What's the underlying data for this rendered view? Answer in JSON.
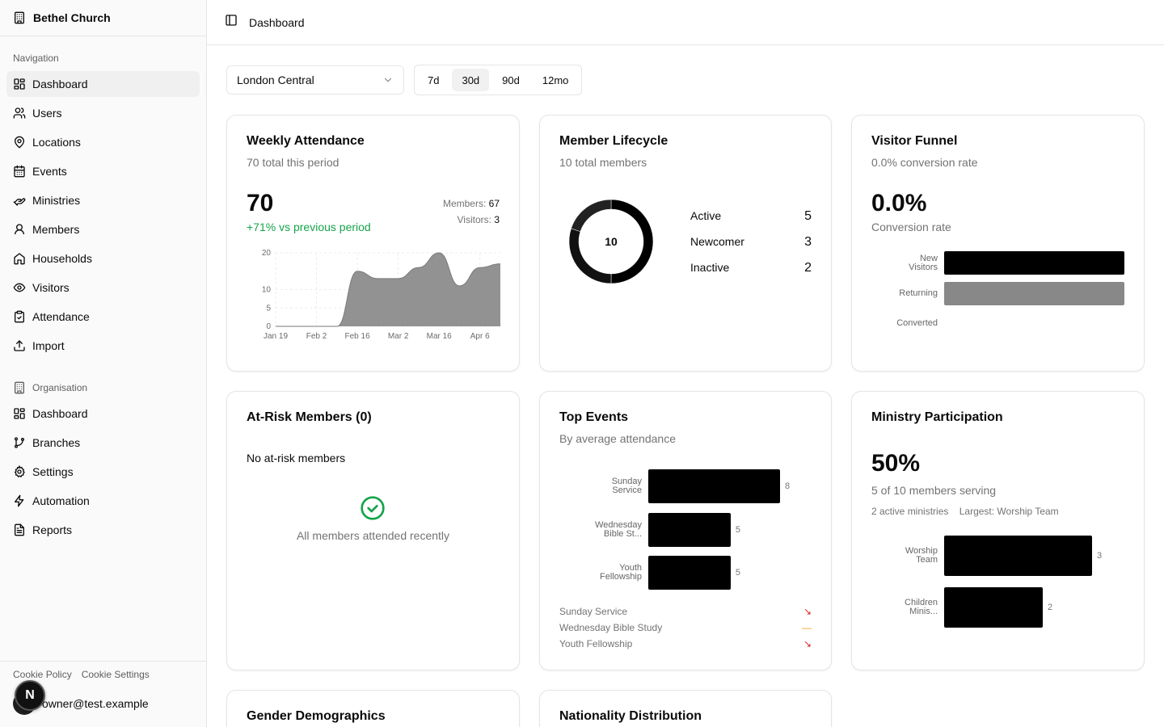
{
  "sidebar": {
    "org_name": "Bethel Church",
    "nav_label": "Navigation",
    "nav_items": [
      "Dashboard",
      "Users",
      "Locations",
      "Events",
      "Ministries",
      "Members",
      "Households",
      "Visitors",
      "Attendance",
      "Import"
    ],
    "org_label": "Organisation",
    "org_items": [
      "Dashboard",
      "Branches",
      "Settings",
      "Automation",
      "Reports"
    ],
    "footer_links": [
      "Cookie Policy",
      "Cookie Settings"
    ],
    "user_email": "owner@test.example",
    "badge": "N"
  },
  "header": {
    "title": "Dashboard"
  },
  "filters": {
    "location": "London Central",
    "ranges": [
      "7d",
      "30d",
      "90d",
      "12mo"
    ],
    "active_range": "30d"
  },
  "weekly_attendance": {
    "title": "Weekly Attendance",
    "subtitle": "70 total this period",
    "total": "70",
    "change": "+71% vs previous period",
    "members_label": "Members:",
    "members_value": "67",
    "visitors_label": "Visitors:",
    "visitors_value": "3",
    "chart_data": {
      "type": "area",
      "x": [
        "Jan 19",
        "Jan 26",
        "Feb 2",
        "Feb 9",
        "Feb 16",
        "Feb 23",
        "Mar 2",
        "Mar 9",
        "Mar 16",
        "Mar 23",
        "Apr 6",
        "Apr 13"
      ],
      "x_ticks": [
        "Jan 19",
        "Feb 2",
        "Feb 16",
        "Mar 2",
        "Mar 16",
        "Apr 6"
      ],
      "values": [
        0,
        0,
        0,
        0,
        15,
        13,
        13,
        16,
        20,
        11,
        16,
        17
      ],
      "y_ticks": [
        0,
        5,
        10,
        20
      ],
      "ylim": [
        0,
        20
      ],
      "grid": true,
      "color": "#8c8c8c"
    }
  },
  "member_lifecycle": {
    "title": "Member Lifecycle",
    "subtitle": "10 total members",
    "center": "10",
    "chart_data": {
      "type": "pie",
      "categories": [
        "Active",
        "Newcomer",
        "Inactive"
      ],
      "values": [
        5,
        3,
        2
      ],
      "colors": [
        "#000000",
        "#111111",
        "#222222"
      ]
    }
  },
  "visitor_funnel": {
    "title": "Visitor Funnel",
    "subtitle": "0.0% conversion rate",
    "rate": "0.0%",
    "rate_label": "Conversion rate",
    "chart_data": {
      "type": "bar",
      "categories": [
        "New Visitors",
        "Returning",
        "Converted"
      ],
      "labels": [
        [
          "New",
          "Visitors"
        ],
        [
          "Returning"
        ],
        [
          "Converted"
        ]
      ],
      "values": [
        3,
        3,
        0
      ],
      "colors": [
        "#000000",
        "#888888",
        "#000000"
      ],
      "xlim": [
        0,
        3
      ]
    }
  },
  "at_risk": {
    "title": "At-Risk Members (0)",
    "empty_title": "No at-risk members",
    "empty_message": "All members attended recently"
  },
  "top_events": {
    "title": "Top Events",
    "subtitle": "By average attendance",
    "chart_data": {
      "type": "bar",
      "categories": [
        "Sunday Service",
        "Wednesday Bible St...",
        "Youth Fellowship"
      ],
      "labels": [
        [
          "Sunday",
          "Service"
        ],
        [
          "Wednesday",
          "Bible St..."
        ],
        [
          "Youth",
          "Fellowship"
        ]
      ],
      "values": [
        8,
        5,
        5
      ],
      "xlim": [
        0,
        8
      ]
    },
    "list": [
      {
        "name": "Sunday Service",
        "trend": "down"
      },
      {
        "name": "Wednesday Bible Study",
        "trend": "flat"
      },
      {
        "name": "Youth Fellowship",
        "trend": "down"
      }
    ]
  },
  "ministry": {
    "title": "Ministry Participation",
    "percent": "50%",
    "serving": "5 of 10 members serving",
    "active": "2 active ministries",
    "largest": "Largest: Worship Team",
    "chart_data": {
      "type": "bar",
      "categories": [
        "Worship Team",
        "Children Minis..."
      ],
      "labels": [
        [
          "Worship",
          "Team"
        ],
        [
          "Children",
          "Minis..."
        ]
      ],
      "values": [
        3,
        2
      ],
      "xlim": [
        0,
        3
      ]
    }
  },
  "gender": {
    "title": "Gender Demographics"
  },
  "nationality": {
    "title": "Nationality Distribution"
  }
}
